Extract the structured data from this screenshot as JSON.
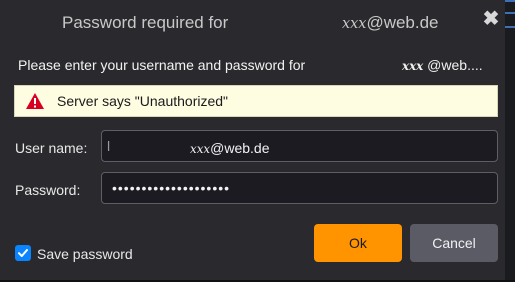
{
  "dialog": {
    "title_prefix": "Password required for",
    "title_masked": "xxx",
    "title_domain": "@web.de",
    "close_glyph": "✖"
  },
  "intro": {
    "text": "Please enter your username and password for",
    "masked": "xxx",
    "domain_truncated": " @web...."
  },
  "alert": {
    "message": "Server says \"Unauthorized\"",
    "icon": "warning-icon",
    "icon_color": "#d70022"
  },
  "form": {
    "username_label": "User name:",
    "username_cursor": "l",
    "username_masked": "xxx",
    "username_domain": "@web.de",
    "password_label": "Password:",
    "password_value": "••••••••••••••••••••"
  },
  "save_password": {
    "label": "Save password",
    "checked": true
  },
  "buttons": {
    "ok": "Ok",
    "cancel": "Cancel"
  },
  "colors": {
    "ok_button": "#ff9400",
    "cancel_button": "#5b5b66",
    "checkbox": "#0a84ff",
    "alert_background": "#fffde1"
  }
}
